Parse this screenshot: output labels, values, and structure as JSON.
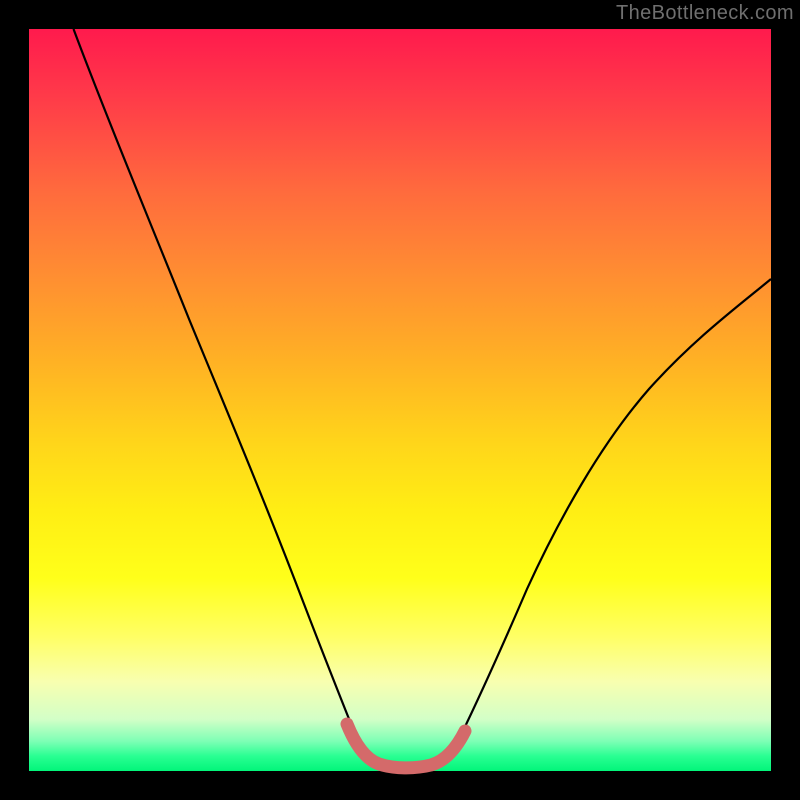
{
  "watermark": "TheBottleneck.com",
  "chart_data": {
    "type": "line",
    "title": "",
    "xlabel": "",
    "ylabel": "",
    "xlim": [
      0,
      100
    ],
    "ylim": [
      0,
      100
    ],
    "grid": false,
    "legend": false,
    "series": [
      {
        "name": "main-curve",
        "color": "#000000",
        "x": [
          6,
          10,
          15,
          20,
          25,
          30,
          35,
          40,
          43,
          45,
          47,
          50,
          53,
          55,
          57,
          60,
          65,
          70,
          75,
          80,
          85,
          90,
          95,
          100
        ],
        "y": [
          100,
          88,
          76,
          65,
          55,
          45,
          35,
          24,
          14,
          8,
          4,
          2,
          2,
          4,
          8,
          14,
          24,
          33,
          41,
          48,
          54,
          59,
          63,
          66
        ]
      },
      {
        "name": "highlight-band",
        "color": "#d46a6a",
        "x": [
          42,
          44,
          46,
          48,
          50,
          52,
          54,
          56,
          58
        ],
        "y": [
          10,
          6,
          3,
          2,
          2,
          2,
          3,
          6,
          10
        ]
      }
    ],
    "gradient_stops": [
      {
        "pos": 0.0,
        "color": "#ff1a4d"
      },
      {
        "pos": 0.22,
        "color": "#ff6b3d"
      },
      {
        "pos": 0.45,
        "color": "#ffb224"
      },
      {
        "pos": 0.65,
        "color": "#ffee14"
      },
      {
        "pos": 0.82,
        "color": "#ffff66"
      },
      {
        "pos": 0.93,
        "color": "#d3ffc7"
      },
      {
        "pos": 1.0,
        "color": "#02f57a"
      }
    ]
  }
}
